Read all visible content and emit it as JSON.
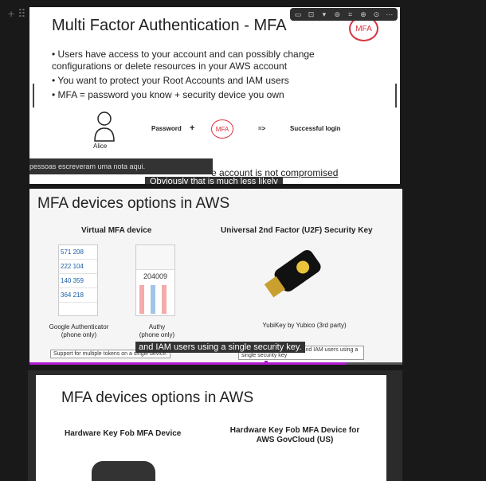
{
  "gutter": {
    "add": "+",
    "drag": "⠿"
  },
  "toolbar": {
    "icons": [
      "comment-icon",
      "align-icon",
      "chevron-down-icon",
      "caption-icon",
      "crop-icon",
      "zoom-icon",
      "download-icon",
      "more-icon"
    ],
    "glyphs": [
      "▭",
      "⊡",
      "▾",
      "⊜",
      "⌗",
      "⊕",
      "⊙",
      "⋯"
    ]
  },
  "slide1": {
    "title": "Multi Factor Authentication - MFA",
    "badge": "MFA",
    "bullets": [
      "• Users have access to your account and can possibly change configurations or delete resources in your AWS account",
      "• You want to protect your Root Accounts and IAM users",
      "• MFA = password you know + security device you own"
    ],
    "alice": "Alice",
    "password": "Password",
    "plus": "+",
    "mfa": "MFA",
    "arrow": "=>",
    "success": "Successful login",
    "overlay_note": "pessoas escreveram uma nota aqui.",
    "bottom_text": "e account is not compromised",
    "bottom_text2": "Obviously that is much less likely"
  },
  "slide2": {
    "title": "MFA devices options in AWS",
    "col1": "Virtual MFA device",
    "col2": "Universal 2nd Factor (U2F) Security Key",
    "ga_codes": [
      "571 208",
      "222 104",
      "140 359",
      "364 218"
    ],
    "authy_code": "204009",
    "ga_caption": "Google Authenticator\n(phone only)",
    "authy_caption": "Authy\n(phone only)",
    "yubi_caption": "YubiKey by Yubico (3rd party)",
    "note_left": "Support for multiple tokens on a single device.",
    "note_right": "Support for multiple root and IAM users using a single security key",
    "subtitle": "and IAM users using a single security key.",
    "progress": 0.85
  },
  "slide3": {
    "title": "MFA devices options in AWS",
    "col1": "Hardware Key Fob MFA Device",
    "col2": "Hardware Key Fob MFA Device for AWS GovCloud (US)"
  }
}
